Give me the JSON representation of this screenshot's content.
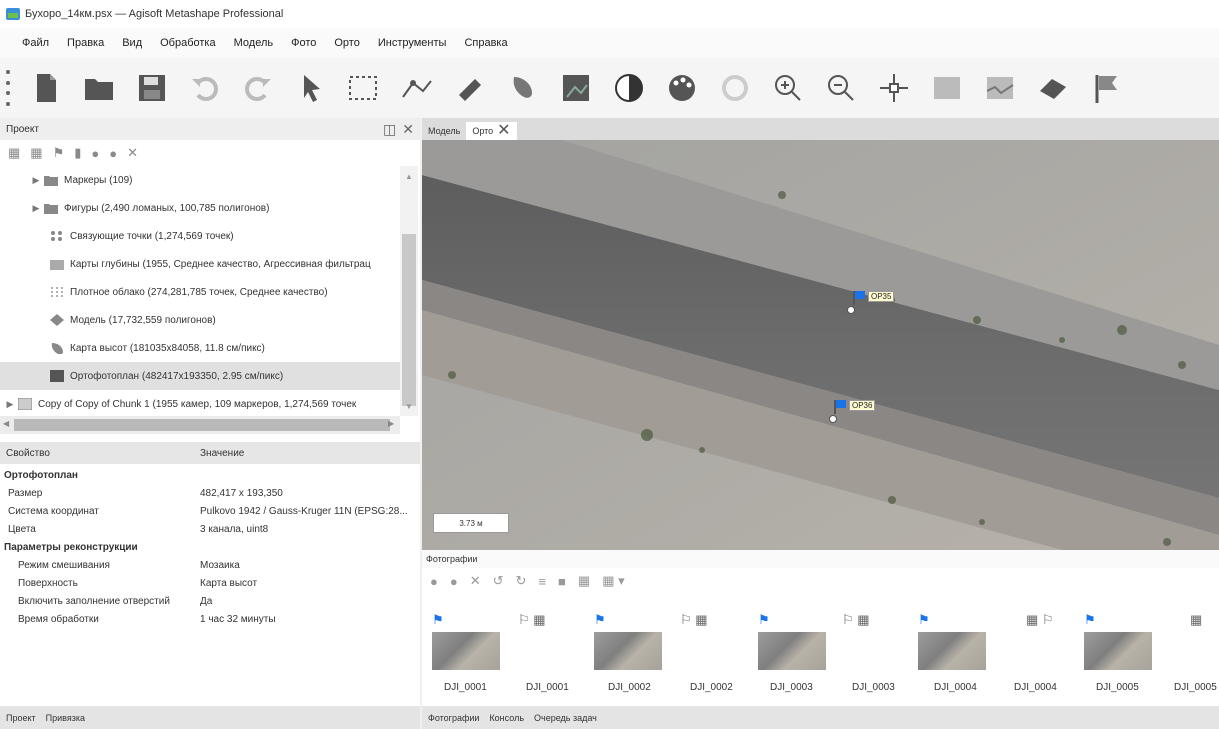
{
  "window": {
    "title": "Бухоро_14км.psx — Agisoft Metashape Professional"
  },
  "menu": [
    "Файл",
    "Правка",
    "Вид",
    "Обработка",
    "Модель",
    "Фото",
    "Орто",
    "Инструменты",
    "Справка"
  ],
  "project_panel": {
    "title": "Проект",
    "tree": [
      {
        "label": "Маркеры (109)",
        "icon": "folder-icon",
        "expandable": true
      },
      {
        "label": "Фигуры (2,490 ломаных, 100,785 полигонов)",
        "icon": "folder-icon",
        "expandable": true
      },
      {
        "label": "Связующие точки (1,274,569 точек)",
        "icon": "tie-points-icon",
        "expandable": false
      },
      {
        "label": "Карты глубины (1955, Среднее качество, Агрессивная фильтрац",
        "icon": "depth-maps-icon",
        "expandable": false
      },
      {
        "label": "Плотное облако (274,281,785 точек, Среднее качество)",
        "icon": "dense-cloud-icon",
        "expandable": false
      },
      {
        "label": "Модель (17,732,559 полигонов)",
        "icon": "model-icon",
        "expandable": false
      },
      {
        "label": "Карта высот (181035x84058, 11.8 см/пикс)",
        "icon": "dem-icon",
        "expandable": false
      },
      {
        "label": "Ортофотоплан (482417x193350, 2.95 см/пикс)",
        "icon": "orthomosaic-icon",
        "expandable": false,
        "selected": true
      },
      {
        "label": "Copy of Copy of Chunk 1 (1955 камер, 109 маркеров, 1,274,569 точек",
        "icon": "chunk-icon",
        "expandable": true
      }
    ]
  },
  "properties": {
    "col_property": "Свойство",
    "col_value": "Значение",
    "rows": [
      {
        "key": "Ортофотоплан",
        "value": "",
        "group": true
      },
      {
        "key": "Размер",
        "value": "482,417 x 193,350"
      },
      {
        "key": "Система координат",
        "value": "Pulkovo 1942 / Gauss-Kruger 11N (EPSG:28..."
      },
      {
        "key": "Цвета",
        "value": "3 канала, uint8"
      },
      {
        "key": "Параметры реконструкции",
        "value": "",
        "group": true
      },
      {
        "key": "Режим смешивания",
        "value": "Мозаика",
        "indent": true
      },
      {
        "key": "Поверхность",
        "value": "Карта высот",
        "indent": true
      },
      {
        "key": "Включить заполнение отверстий",
        "value": "Да",
        "indent": true
      },
      {
        "key": "Время обработки",
        "value": "1 час 32 минуты",
        "indent": true
      }
    ]
  },
  "left_tabs": [
    "Проект",
    "Привязка"
  ],
  "view_tabs": [
    "Модель",
    "Орто"
  ],
  "ortho": {
    "scale": "3.73 м",
    "markers": [
      {
        "label": "OP35"
      },
      {
        "label": "OP36"
      }
    ]
  },
  "photos_panel": {
    "title": "Фотографии",
    "labels": [
      "DJI_0001",
      "DJI_0001",
      "DJI_0002",
      "DJI_0002",
      "DJI_0003",
      "DJI_0003",
      "DJI_0004",
      "DJI_0004",
      "DJI_0005",
      "DJI_0005"
    ]
  },
  "bottom_tabs": [
    "Фотографии",
    "Консоль",
    "Очередь задач"
  ],
  "colors": {
    "accent": "#1a73e8",
    "selection": "#e0e0e0"
  }
}
